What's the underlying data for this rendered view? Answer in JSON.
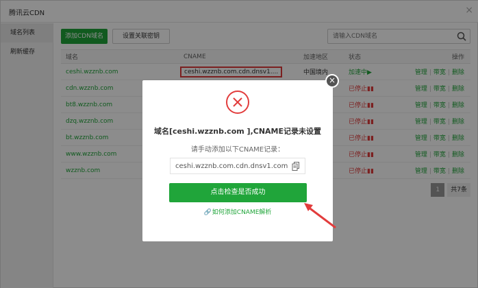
{
  "window": {
    "title": "腾讯云CDN",
    "close_glyph": "×"
  },
  "sidebar": {
    "items": [
      {
        "label": "域名列表"
      },
      {
        "label": "刷新缓存"
      }
    ]
  },
  "toolbar": {
    "add_domain": "添加CDN域名",
    "set_key": "设置关联密钥"
  },
  "search": {
    "placeholder": "请输入CDN域名"
  },
  "table": {
    "headers": {
      "domain": "域名",
      "cname": "CNAME",
      "region": "加速地区",
      "status": "状态",
      "ops": "操作"
    },
    "rows": [
      {
        "domain": "ceshi.wzznb.com",
        "cname": "ceshi.wzznb.com.cdn.dnsv1....",
        "region": "中国境内",
        "status": "加速中",
        "status_icon": "▶"
      },
      {
        "domain": "cdn.wzznb.com",
        "cname": "",
        "region": "",
        "status": "已停止",
        "status_icon": "▮▮"
      },
      {
        "domain": "bt8.wzznb.com",
        "cname": "",
        "region": "",
        "status": "已停止",
        "status_icon": "▮▮"
      },
      {
        "domain": "dzq.wzznb.com",
        "cname": "",
        "region": "",
        "status": "已停止",
        "status_icon": "▮▮"
      },
      {
        "domain": "bt.wzznb.com",
        "cname": "",
        "region": "",
        "status": "已停止",
        "status_icon": "▮▮"
      },
      {
        "domain": "www.wzznb.com",
        "cname": "",
        "region": "",
        "status": "已停止",
        "status_icon": "▮▮"
      },
      {
        "domain": "wzznb.com",
        "cname": "",
        "region": "",
        "status": "已停止",
        "status_icon": "▮▮"
      }
    ],
    "op_labels": {
      "manage": "管理",
      "bandwidth": "带宽",
      "delete": "删除",
      "separator": "|"
    }
  },
  "pager": {
    "current": "1",
    "total": "共7条"
  },
  "modal": {
    "title": "域名[ceshi.wzznb.com ],CNAME记录未设置",
    "subtitle": "请手动添加以下CNAME记录：",
    "cname_value": "ceshi.wzznb.com.cdn.dnsv1.com",
    "check_button": "点击检查是否成功",
    "help_icon": "🔗",
    "help_link": "如何添加CNAME解析",
    "close_glyph": "×"
  },
  "colors": {
    "accent": "#20a53a",
    "error": "#e23c3c",
    "overlay": "rgba(0,0,0,0.45)"
  }
}
